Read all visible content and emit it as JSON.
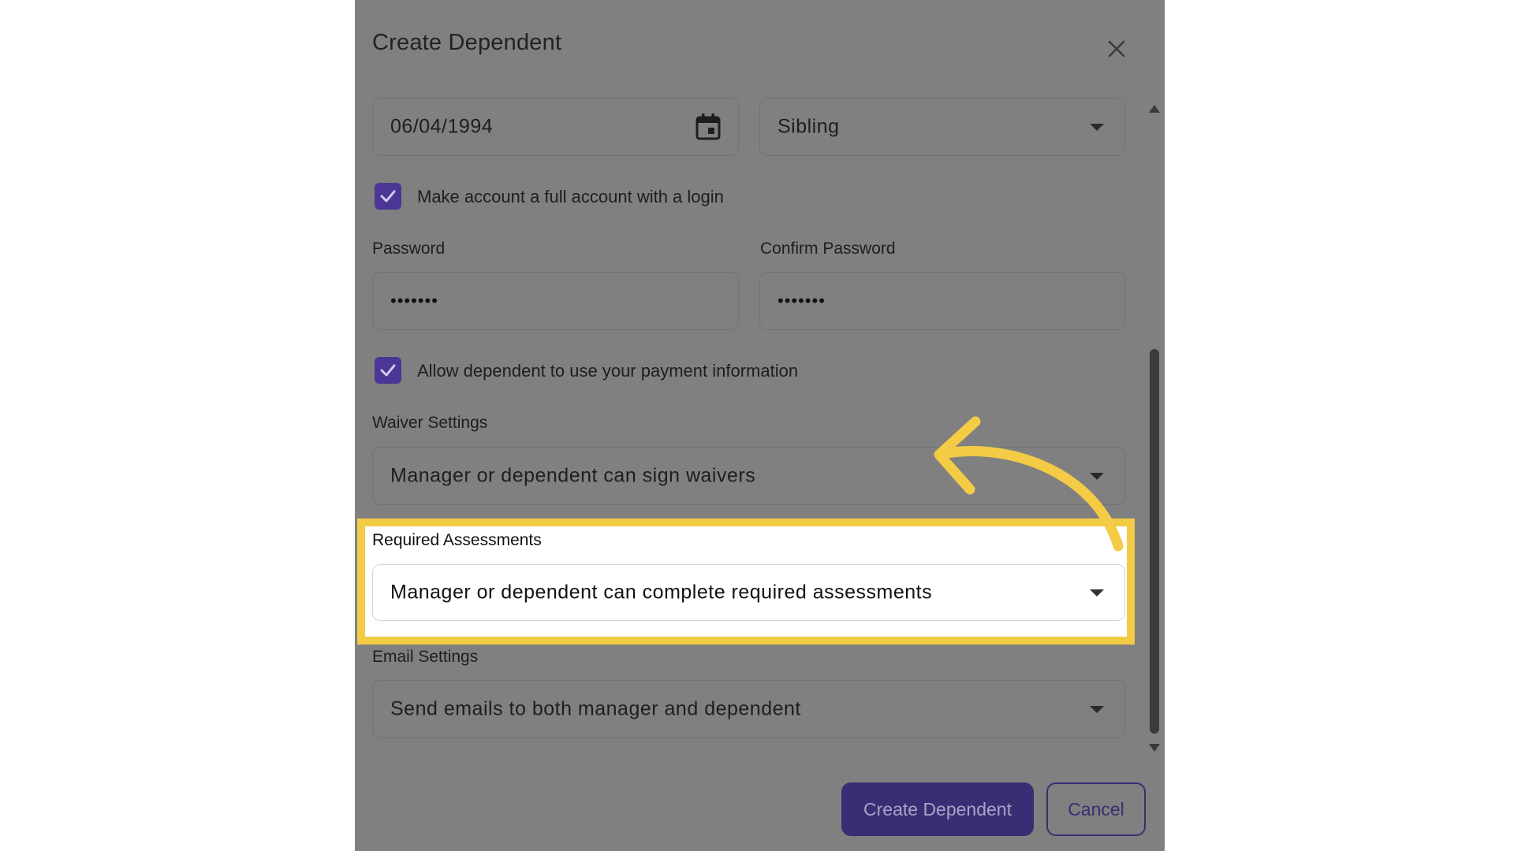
{
  "dialog": {
    "title": "Create Dependent",
    "close_icon": "close-icon"
  },
  "form": {
    "birthdate": {
      "value": "06/04/1994",
      "icon": "calendar-icon"
    },
    "relationship": {
      "value": "Sibling"
    },
    "full_account_checkbox": {
      "checked": true,
      "label": "Make account a full account with a login"
    },
    "password": {
      "label": "Password",
      "masked_value": "•••••••"
    },
    "confirm_password": {
      "label": "Confirm Password",
      "masked_value": "•••••••"
    },
    "payment_checkbox": {
      "checked": true,
      "label": "Allow dependent to use your payment information"
    },
    "waiver_settings": {
      "label": "Waiver Settings",
      "value": "Manager or dependent can sign waivers"
    },
    "required_assessments": {
      "label": "Required Assessments",
      "value": "Manager or dependent can complete required assessments"
    },
    "email_settings": {
      "label": "Email Settings",
      "value": "Send emails to both manager and dependent"
    }
  },
  "buttons": {
    "create_label": "Create Dependent",
    "cancel_label": "Cancel"
  },
  "annotation": {
    "highlight_color": "#f4cb45",
    "arrow_icon": "curved-arrow-icon"
  },
  "colors": {
    "accent": "#4b3696",
    "overlay": "#808080"
  }
}
